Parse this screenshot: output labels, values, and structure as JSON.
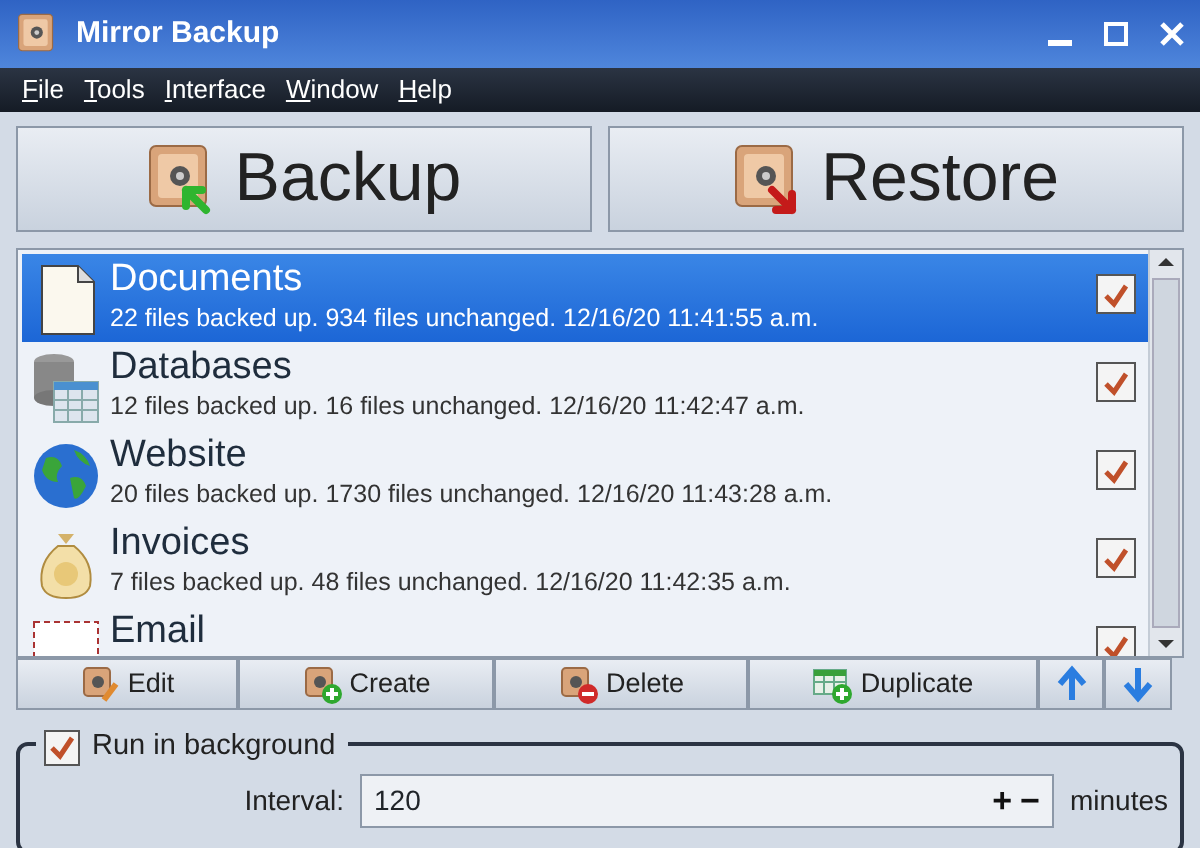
{
  "window": {
    "title": "Mirror Backup"
  },
  "menu": [
    "File",
    "Tools",
    "Interface",
    "Window",
    "Help"
  ],
  "actions": [
    {
      "label": "Backup",
      "kind": "backup"
    },
    {
      "label": "Restore",
      "kind": "restore"
    }
  ],
  "jobs": [
    {
      "name": "Documents",
      "status": "22 files backed up.  934 files unchanged.  12/16/20 11:41:55 a.m.",
      "kind": "document",
      "checked": true,
      "selected": true
    },
    {
      "name": "Databases",
      "status": "12 files backed up.  16 files unchanged.  12/16/20 11:42:47 a.m.",
      "kind": "database",
      "checked": true,
      "selected": false
    },
    {
      "name": "Website",
      "status": "20 files backed up.  1730 files unchanged.  12/16/20 11:43:28 a.m.",
      "kind": "globe",
      "checked": true,
      "selected": false
    },
    {
      "name": "Invoices",
      "status": "7 files backed up.  48 files unchanged.  12/16/20 11:42:35 a.m.",
      "kind": "money",
      "checked": true,
      "selected": false
    },
    {
      "name": "Email",
      "kind": "email",
      "checked": true,
      "selected": false
    }
  ],
  "toolbar": [
    {
      "label": "Edit",
      "kind": "edit"
    },
    {
      "label": "Create",
      "kind": "create"
    },
    {
      "label": "Delete",
      "kind": "delete"
    },
    {
      "label": "Duplicate",
      "kind": "duplicate"
    },
    {
      "kind": "up"
    },
    {
      "kind": "down"
    }
  ],
  "background": {
    "label": "Run in background",
    "checked": true,
    "interval_label": "Interval:",
    "interval_value": "120",
    "plus": "+",
    "minus": "−",
    "unit": "minutes"
  }
}
